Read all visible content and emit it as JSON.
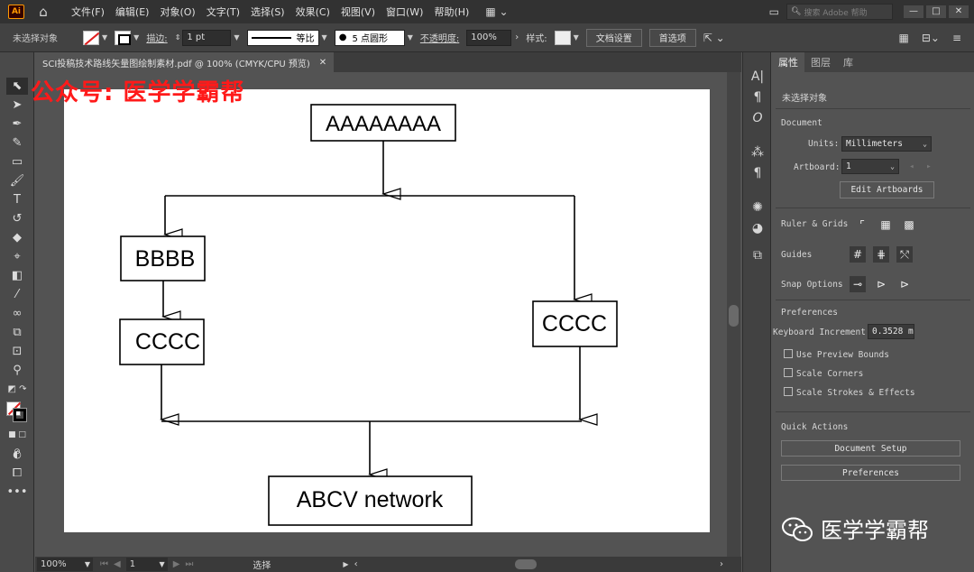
{
  "app": {
    "logo": "Ai",
    "menu": [
      "文件(F)",
      "编辑(E)",
      "对象(O)",
      "文字(T)",
      "选择(S)",
      "效果(C)",
      "视图(V)",
      "窗口(W)",
      "帮助(H)"
    ],
    "search_placeholder": "搜索 Adobe 帮助"
  },
  "control": {
    "selection_status": "未选择对象",
    "stroke_label": "描边:",
    "stroke_weight": "1 pt",
    "profile": "等比",
    "brush": "5 点圆形",
    "opacity_label": "不透明度:",
    "opacity_value": "100%",
    "style_label": "样式:",
    "doc_setup_button": "文档设置",
    "prefs_button": "首选项"
  },
  "document": {
    "tab_title": "SCI投稿技术路线矢量图绘制素材.pdf @ 100% (CMYK/CPU 预览)"
  },
  "watermark": {
    "top": "公众号: 医学学霸帮",
    "bottom": "医学学霸帮"
  },
  "flowchart": {
    "top": "AAAAAAAA",
    "left1": "BBBB",
    "left2": "CCCC",
    "right": "CCCC",
    "bottom": "ABCV network"
  },
  "status": {
    "zoom": "100%",
    "artboard": "1",
    "tool": "选择"
  },
  "properties": {
    "tabs": [
      "属性",
      "图层",
      "库"
    ],
    "no_selection": "未选择对象",
    "document_heading": "Document",
    "units_label": "Units:",
    "units_value": "Millimeters",
    "artboard_label": "Artboard:",
    "artboard_value": "1",
    "edit_artboards": "Edit Artboards",
    "ruler_grids": "Ruler & Grids",
    "guides": "Guides",
    "snap_options": "Snap Options",
    "preferences_heading": "Preferences",
    "keyboard_increment_label": "Keyboard Increment:",
    "keyboard_increment_value": "0.3528 mm",
    "use_preview_bounds": "Use Preview Bounds",
    "scale_corners": "Scale Corners",
    "scale_strokes": "Scale Strokes & Effects",
    "quick_actions": "Quick Actions",
    "document_setup": "Document Setup",
    "preferences_button": "Preferences"
  }
}
